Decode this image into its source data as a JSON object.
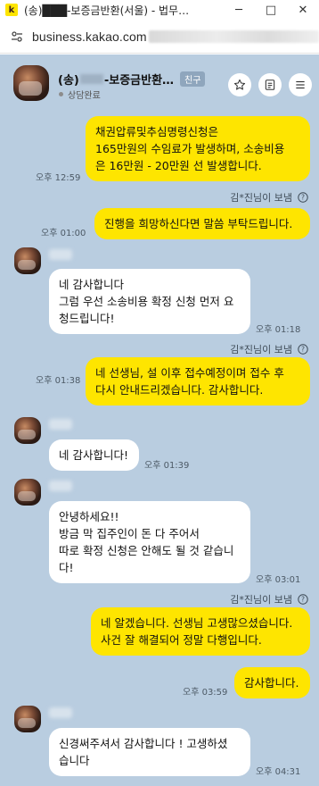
{
  "window": {
    "title": "(송)███-보증금반환(서울) - 법무…",
    "controls": {
      "minimize": "─",
      "maximize": "□",
      "close": "✕"
    }
  },
  "address_bar": {
    "url": "business.kakao.com"
  },
  "chat_header": {
    "name_prefix": "(송)",
    "name_suffix": "-보증금반환…",
    "friend_badge": "친구",
    "status": "상담완료",
    "actions": [
      "star-icon",
      "notes-icon",
      "menu-icon"
    ]
  },
  "messages": [
    {
      "side": "mine",
      "lines": [
        "채권압류및추심명령신청은",
        "165만원의 수임료가 발생하며, 소송비용",
        "은 16만원 - 20만원 선 발생합니다."
      ],
      "time": "오후 12:59",
      "sent_by": "김*진님이 보냄"
    },
    {
      "side": "mine",
      "lines": [
        "진행을 희망하신다면 말씀 부탁드립니다."
      ],
      "time": "오후 01:00"
    },
    {
      "side": "theirs",
      "lines": [
        "네 감사합니다",
        "그럼 우선 소송비용 확정 신청 먼저 요",
        "청드립니다!"
      ],
      "time": "오후 01:18"
    },
    {
      "side": "mine",
      "lines": [
        "네 선생님, 설 이후 접수예정이며 접수 후",
        "다시 안내드리겠습니다. 감사합니다."
      ],
      "time": "오후 01:38",
      "sent_by": "김*진님이 보냄"
    },
    {
      "side": "theirs",
      "lines": [
        "네 감사합니다!"
      ],
      "time": "오후 01:39"
    },
    {
      "side": "theirs",
      "lines": [
        "안녕하세요!!",
        "방금 막 집주인이 돈 다 주어서",
        "따로 확정 신청은 안해도 될 것 같습니",
        "다!"
      ],
      "time": "오후 03:01"
    },
    {
      "side": "mine",
      "lines": [
        "네 알겠습니다. 선생님 고생많으셨습니다.",
        "사건 잘 해결되어 정말 다행입니다."
      ],
      "time": "오후 03:59",
      "sent_by": "김*진님이 보냄"
    },
    {
      "side": "mine",
      "lines": [
        "감사합니다."
      ]
    },
    {
      "side": "theirs",
      "lines": [
        "신경써주셔서 감사합니다 ! 고생하셨",
        "습니다"
      ],
      "time": "오후 04:31"
    }
  ],
  "colors": {
    "chat_background": "#b9cde0",
    "my_bubble": "#fee500",
    "their_bubble": "#ffffff",
    "brand": "#fee500"
  }
}
